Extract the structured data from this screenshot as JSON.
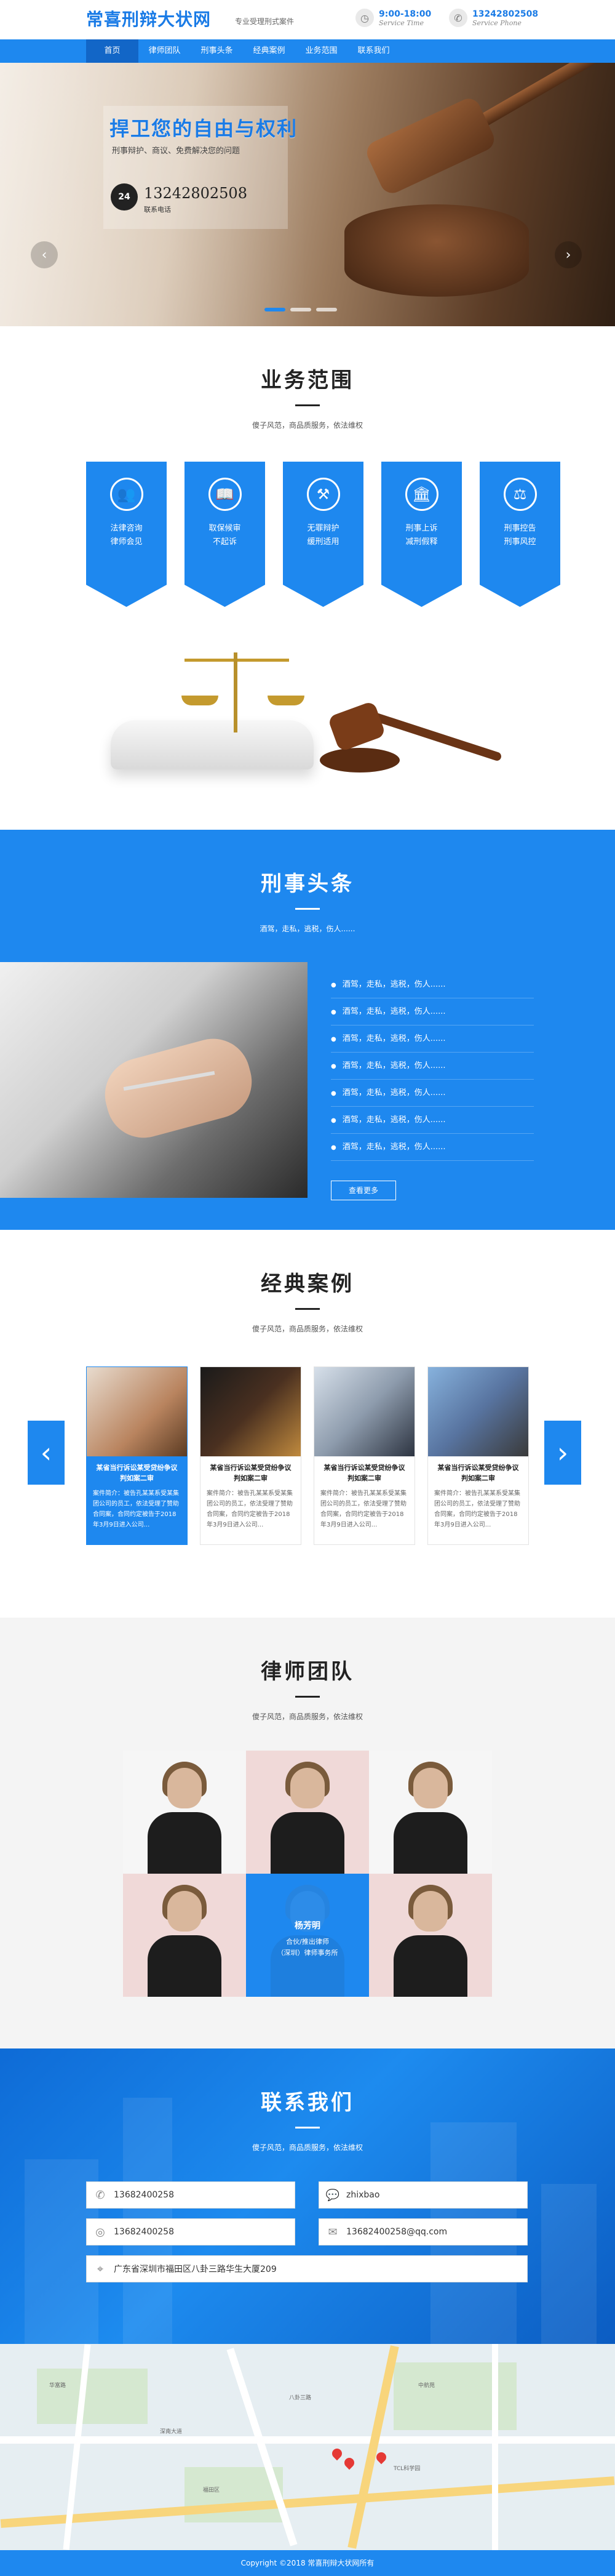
{
  "header": {
    "logo": "常喜刑辩大状网",
    "slogan": "专业受理刑式案件",
    "time_main": "9:00-18:00",
    "time_sub": "Service Time",
    "phone_main": "13242802508",
    "phone_sub": "Service Phone"
  },
  "nav": [
    "首页",
    "律师团队",
    "刑事头条",
    "经典案例",
    "业务范围",
    "联系我们"
  ],
  "hero": {
    "title": "捍卫您的自由与权利",
    "subtitle": "刑事辩护、商议、免费解决您的问题",
    "phone": "13242802508",
    "phone_label": "联系电话",
    "hotline_badge": "24"
  },
  "services": {
    "title": "业务范围",
    "subtitle": "傻子风范，商品质服务，依法维权",
    "items": [
      {
        "line1": "法律咨询",
        "line2": "律师会见",
        "icon": "users-icon"
      },
      {
        "line1": "取保候审",
        "line2": "不起诉",
        "icon": "book-icon"
      },
      {
        "line1": "无罪辩护",
        "line2": "缓刑适用",
        "icon": "gavel-icon"
      },
      {
        "line1": "刑事上诉",
        "line2": "减刑假释",
        "icon": "court-icon"
      },
      {
        "line1": "刑事控告",
        "line2": "刑事风控",
        "icon": "scales-icon"
      }
    ]
  },
  "news": {
    "title": "刑事头条",
    "subtitle": "酒驾，走私，逃税，伤人......",
    "items": [
      "酒驾，走私，逃税，伤人......",
      "酒驾，走私，逃税，伤人......",
      "酒驾，走私，逃税，伤人......",
      "酒驾，走私，逃税，伤人......",
      "酒驾，走私，逃税，伤人......",
      "酒驾，走私，逃税，伤人......",
      "酒驾，走私，逃税，伤人......"
    ],
    "more": "查看更多"
  },
  "cases": {
    "title": "经典案例",
    "subtitle": "傻子风范，商品质服务，依法维权",
    "items": [
      {
        "title": "某省当行诉讼某受贷纷争议 判如案二审",
        "desc": "案件简介：被告孔某某系受某集团公司的员工，依法受理了赞助合同案，合同约定被告于2018年3月9日进入公司..."
      },
      {
        "title": "某省当行诉讼某受贷纷争议 判如案二审",
        "desc": "案件简介：被告孔某某系受某集团公司的员工，依法受理了赞助合同案，合同约定被告于2018年3月9日进入公司..."
      },
      {
        "title": "某省当行诉讼某受贷纷争议 判如案二审",
        "desc": "案件简介：被告孔某某系受某集团公司的员工，依法受理了赞助合同案，合同约定被告于2018年3月9日进入公司..."
      },
      {
        "title": "某省当行诉讼某受贷纷争议 判如案二审",
        "desc": "案件简介：被告孔某某系受某集团公司的员工，依法受理了赞助合同案，合同约定被告于2018年3月9日进入公司..."
      }
    ]
  },
  "team": {
    "title": "律师团队",
    "subtitle": "傻子风范，商品质服务，依法维权",
    "featured": {
      "name": "杨芳明",
      "line1": "合伙/推出律师",
      "line2": "（深圳）律师事务所"
    }
  },
  "contact": {
    "title": "联系我们",
    "subtitle": "傻子风范，商品质服务，依法维权",
    "phone1": "13682400258",
    "wechat": "zhixbao",
    "qq": "13682400258",
    "email": "13682400258@qq.com",
    "address": "广东省深圳市福田区八卦三路华生大厦209"
  },
  "map": {
    "labels": [
      "华富路",
      "深南大道",
      "八卦三路",
      "福田区",
      "中航苑",
      "TCL科学园"
    ]
  },
  "footer": "Copyright ©2018   常喜刑辩大状网所有",
  "colors": {
    "brand_blue": "#1e88ef",
    "dark_blue": "#1266c7"
  }
}
